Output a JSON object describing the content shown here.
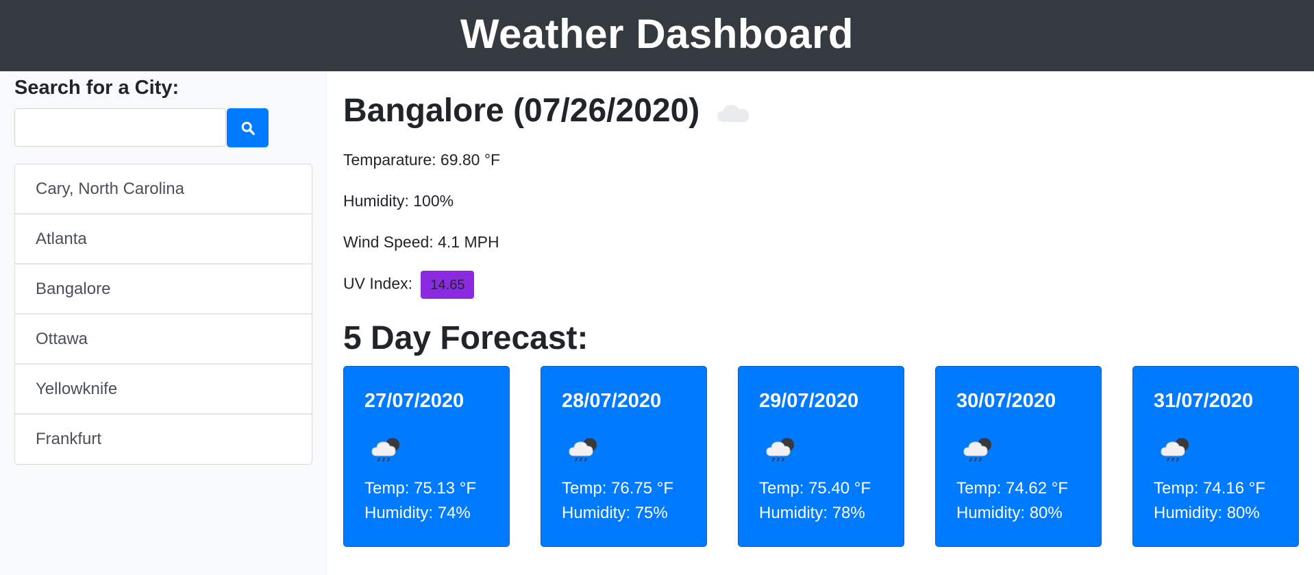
{
  "header": {
    "title": "Weather Dashboard"
  },
  "sidebar": {
    "search_label": "Search for a City:",
    "search_placeholder": "",
    "search_value": "",
    "cities": [
      {
        "label": "Cary, North Carolina"
      },
      {
        "label": "Atlanta"
      },
      {
        "label": "Bangalore"
      },
      {
        "label": "Ottawa"
      },
      {
        "label": "Yellowknife"
      },
      {
        "label": "Frankfurt"
      }
    ]
  },
  "current": {
    "title": "Bangalore (07/26/2020)",
    "icon": "cloud-icon",
    "temperature": "Temparature: 69.80 °F",
    "humidity": "Humidity: 100%",
    "wind": "Wind Speed: 4.1 MPH",
    "uv_label": "UV Index:",
    "uv_value": "14.65",
    "uv_color": "#8a2be2"
  },
  "forecast": {
    "title": "5 Day Forecast:",
    "days": [
      {
        "date": "27/07/2020",
        "icon": "rain-cloud-icon",
        "temp": "Temp: 75.13 °F",
        "humidity": "Humidity: 74%"
      },
      {
        "date": "28/07/2020",
        "icon": "rain-cloud-icon",
        "temp": "Temp: 76.75 °F",
        "humidity": "Humidity: 75%"
      },
      {
        "date": "29/07/2020",
        "icon": "rain-cloud-icon",
        "temp": "Temp: 75.40 °F",
        "humidity": "Humidity: 78%"
      },
      {
        "date": "30/07/2020",
        "icon": "rain-cloud-icon",
        "temp": "Temp: 74.62 °F",
        "humidity": "Humidity: 80%"
      },
      {
        "date": "31/07/2020",
        "icon": "rain-cloud-icon",
        "temp": "Temp: 74.16 °F",
        "humidity": "Humidity: 80%"
      }
    ]
  },
  "colors": {
    "header_bg": "#343a40",
    "accent": "#007bff",
    "sidebar_bg": "#f8f9fa"
  }
}
